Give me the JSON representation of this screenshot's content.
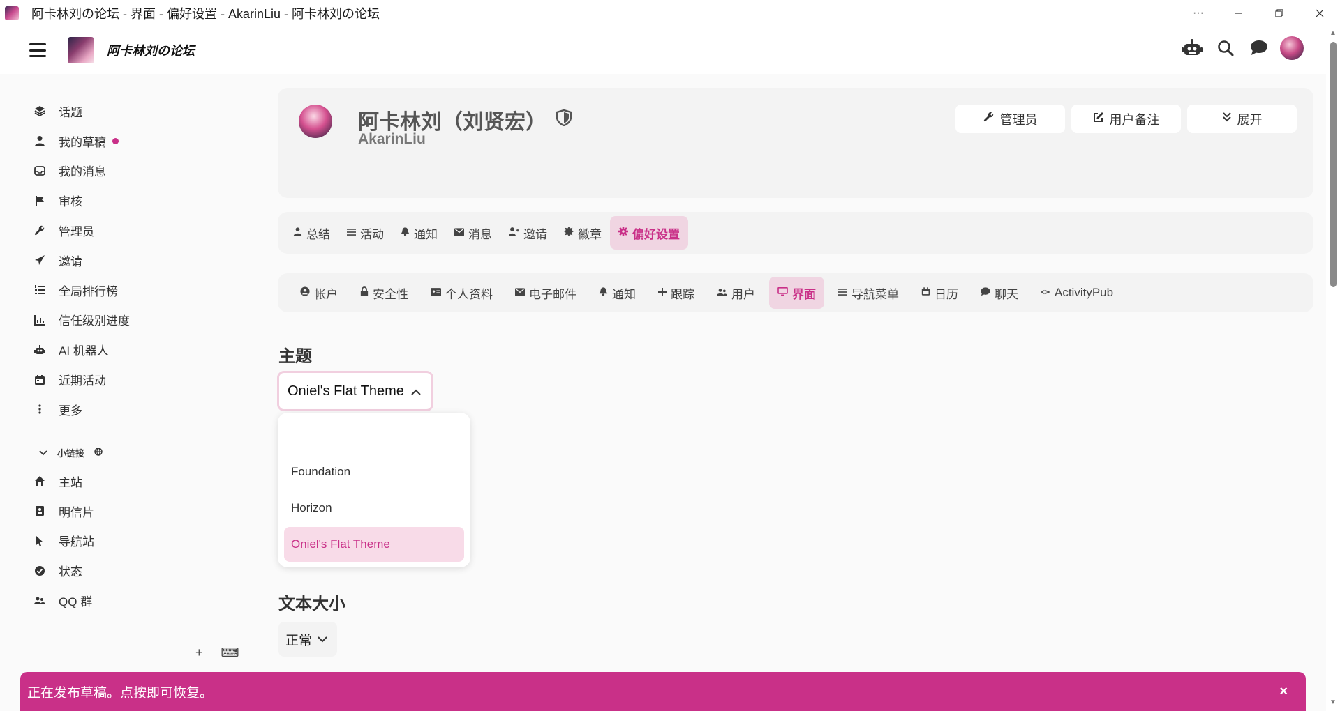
{
  "window": {
    "title": "阿卡林刘の论坛 - 界面 - 偏好设置 - AkarinLiu - 阿卡林刘の论坛",
    "controls": [
      "more-icon",
      "minimize-icon",
      "restore-icon",
      "close-icon"
    ]
  },
  "header": {
    "site_name": "阿卡林刘の论坛",
    "icons": [
      "robot-icon",
      "search-icon",
      "chat-icon",
      "avatar"
    ]
  },
  "sidebar": {
    "items": [
      {
        "label": "话题",
        "icon": "layers-icon"
      },
      {
        "label": "我的草稿",
        "icon": "user-icon",
        "has_dot": true
      },
      {
        "label": "我的消息",
        "icon": "inbox-icon"
      },
      {
        "label": "审核",
        "icon": "flag-icon"
      },
      {
        "label": "管理员",
        "icon": "wrench-icon"
      },
      {
        "label": "邀请",
        "icon": "paper-plane-icon"
      },
      {
        "label": "全局排行榜",
        "icon": "list-ol-icon"
      },
      {
        "label": "信任级别进度",
        "icon": "chart-icon"
      },
      {
        "label": "AI 机器人",
        "icon": "robot-icon"
      },
      {
        "label": "近期活动",
        "icon": "calendar-icon"
      },
      {
        "label": "更多",
        "icon": "more-vertical-icon"
      }
    ],
    "section_title": "小链接",
    "links": [
      {
        "label": "主站",
        "icon": "home-icon"
      },
      {
        "label": "明信片",
        "icon": "address-card-icon"
      },
      {
        "label": "导航站",
        "icon": "cursor-icon"
      },
      {
        "label": "状态",
        "icon": "check-circle-icon"
      },
      {
        "label": "QQ 群",
        "icon": "users-icon"
      }
    ],
    "footer": {
      "add": "+",
      "keyboard": "⌨"
    }
  },
  "profile": {
    "name": "阿卡林刘（刘贤宏）",
    "username": "AkarinLiu",
    "actions": [
      {
        "label": "管理员",
        "icon": "wrench-icon"
      },
      {
        "label": "用户备注",
        "icon": "edit-icon"
      },
      {
        "label": "展开",
        "icon": "double-chevron-down-icon"
      }
    ]
  },
  "tabs": [
    {
      "label": "总结",
      "icon": "user-icon"
    },
    {
      "label": "活动",
      "icon": "list-icon"
    },
    {
      "label": "通知",
      "icon": "bell-icon"
    },
    {
      "label": "消息",
      "icon": "envelope-icon"
    },
    {
      "label": "邀请",
      "icon": "user-plus-icon"
    },
    {
      "label": "徽章",
      "icon": "certificate-icon"
    },
    {
      "label": "偏好设置",
      "icon": "gear-icon",
      "active": true
    }
  ],
  "pref_tabs": [
    {
      "label": "帐户",
      "icon": "user-circle-icon"
    },
    {
      "label": "安全性",
      "icon": "lock-icon"
    },
    {
      "label": "个人资料",
      "icon": "id-card-icon"
    },
    {
      "label": "电子邮件",
      "icon": "envelope-icon"
    },
    {
      "label": "通知",
      "icon": "bell-icon"
    },
    {
      "label": "跟踪",
      "icon": "plus-icon"
    },
    {
      "label": "用户",
      "icon": "users-icon"
    },
    {
      "label": "界面",
      "icon": "desktop-icon",
      "active": true
    },
    {
      "label": "导航菜单",
      "icon": "bars-icon"
    },
    {
      "label": "日历",
      "icon": "calendar-icon"
    },
    {
      "label": "聊天",
      "icon": "comment-icon"
    },
    {
      "label": "ActivityPub",
      "icon": "activitypub-icon"
    }
  ],
  "theme": {
    "title": "主题",
    "selected": "Oniel's Flat Theme",
    "options": [
      "",
      "Foundation",
      "Horizon",
      "Oniel's Flat Theme"
    ]
  },
  "text_size": {
    "title": "文本大小",
    "selected": "正常"
  },
  "toast": {
    "message": "正在发布草稿。点按即可恢复。",
    "close": "×"
  },
  "colors": {
    "accent": "#c93088",
    "accent_light": "#f0d5e2",
    "card_bg": "#f3f3f3"
  }
}
